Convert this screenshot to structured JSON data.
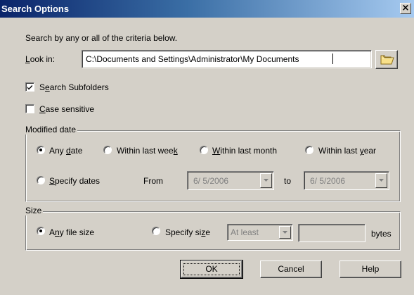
{
  "dialog": {
    "title": "Search Options",
    "close_glyph": "×"
  },
  "intro_text": "Search by any or all of the criteria below.",
  "look_in": {
    "label_u": "L",
    "label_rest": "ook in:",
    "value": "C:\\Documents and Settings\\Administrator\\My Documents",
    "browse_icon": "folder-icon"
  },
  "search_subfolders": {
    "checked": true,
    "label_pre": "S",
    "label_u": "e",
    "label_rest": "arch Subfolders"
  },
  "case_sensitive": {
    "checked": false,
    "label_u": "C",
    "label_rest": "ase sensitive"
  },
  "modified_date": {
    "legend": "Modified date",
    "options": {
      "any_date": {
        "pre": "Any ",
        "u": "d",
        "rest": "ate",
        "selected": true
      },
      "last_week": {
        "pre": "Within last wee",
        "u": "k",
        "rest": "",
        "selected": false
      },
      "last_month": {
        "pre": "",
        "u": "W",
        "rest": "ithin last month",
        "selected": false
      },
      "last_year": {
        "pre": "Within last ",
        "u": "y",
        "rest": "ear",
        "selected": false
      },
      "specify": {
        "pre": "",
        "u": "S",
        "rest": "pecify dates",
        "selected": false
      }
    },
    "from_label": "From",
    "from_value": "6/ 5/2006",
    "to_label": "to",
    "to_value": "6/ 5/2006"
  },
  "size": {
    "legend": "Size",
    "any_size": {
      "pre": "A",
      "u": "n",
      "rest": "y file size",
      "selected": true
    },
    "specify_size": {
      "pre": "Specify si",
      "u": "z",
      "rest": "e",
      "selected": false
    },
    "comparator_value": "At least",
    "amount_value": "",
    "unit_label": "bytes"
  },
  "buttons": {
    "ok": "OK",
    "cancel": "Cancel",
    "help": "Help"
  },
  "colors": {
    "face": "#d4d0c8",
    "title_start": "#0a246a",
    "title_end": "#a6caf0"
  }
}
